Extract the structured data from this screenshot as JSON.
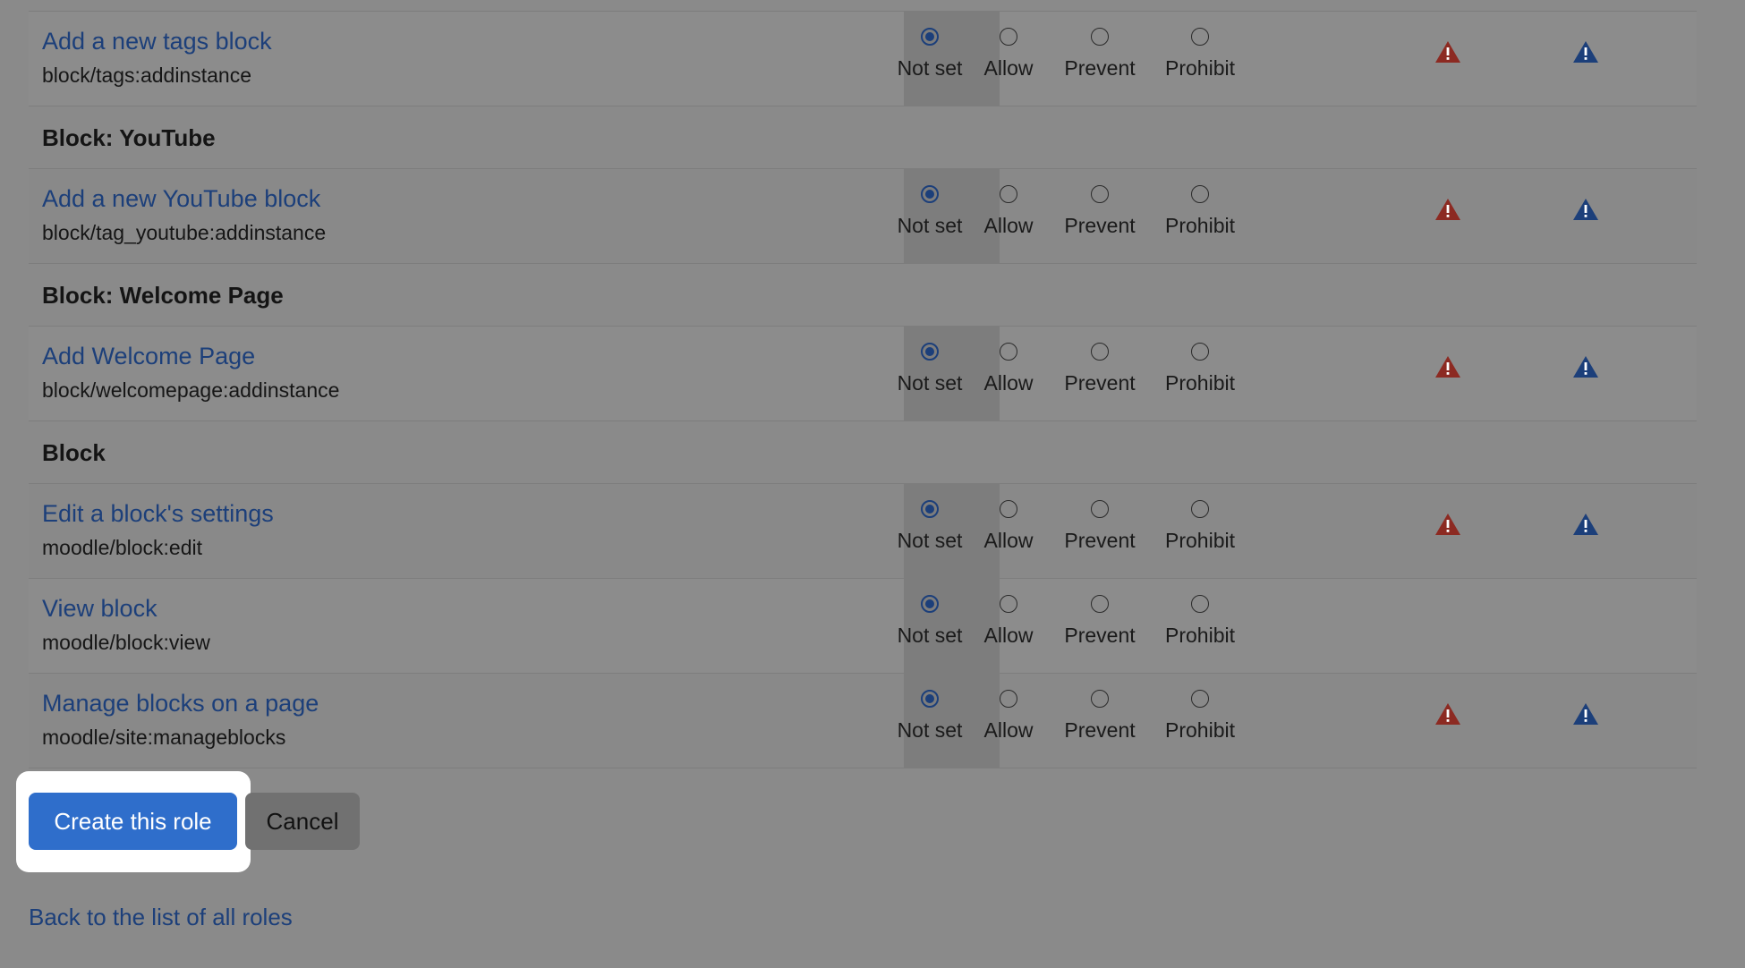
{
  "option_labels": [
    "Not set",
    "Allow",
    "Prevent",
    "Prohibit"
  ],
  "rows": [
    {
      "kind": "cap",
      "name": "Add a new tags block",
      "id": "block/tags:addinstance",
      "selected": 0,
      "risks": [
        "risk-red-icon",
        "risk-blue-icon"
      ]
    },
    {
      "kind": "group",
      "title": "Block: YouTube"
    },
    {
      "kind": "cap",
      "name": "Add a new YouTube block",
      "id": "block/tag_youtube:addinstance",
      "selected": 0,
      "risks": [
        "risk-red-icon",
        "risk-blue-icon"
      ]
    },
    {
      "kind": "group",
      "title": "Block: Welcome Page"
    },
    {
      "kind": "cap",
      "name": "Add Welcome Page",
      "id": "block/welcomepage:addinstance",
      "selected": 0,
      "risks": [
        "risk-red-icon",
        "risk-blue-icon"
      ]
    },
    {
      "kind": "group",
      "title": "Block"
    },
    {
      "kind": "cap",
      "name": "Edit a block's settings",
      "id": "moodle/block:edit",
      "selected": 0,
      "risks": [
        "risk-red-icon",
        "risk-blue-icon"
      ]
    },
    {
      "kind": "cap",
      "name": "View block",
      "id": "moodle/block:view",
      "selected": 0,
      "risks": []
    },
    {
      "kind": "cap",
      "name": "Manage blocks on a page",
      "id": "moodle/site:manageblocks",
      "selected": 0,
      "risks": [
        "risk-red-icon",
        "risk-blue-icon"
      ]
    }
  ],
  "buttons": {
    "create_label": "Create this role",
    "cancel_label": "Cancel"
  },
  "back_link": "Back to the list of all roles",
  "colors": {
    "risk_red": "#8c2a22",
    "risk_blue": "#1c3f7a",
    "primary": "#2f6ecb"
  }
}
